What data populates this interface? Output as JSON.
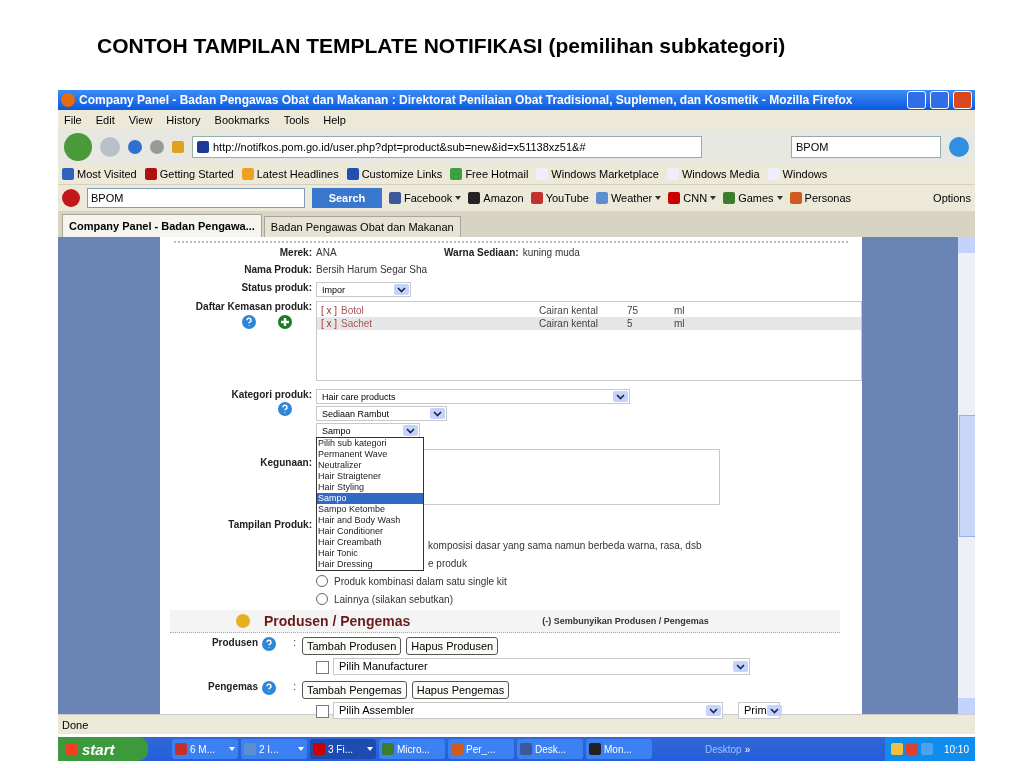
{
  "slide_title": "CONTOH TAMPILAN TEMPLATE NOTIFIKASI (pemilihan subkategori)",
  "window": {
    "title": "Company Panel - Badan Pengawas Obat dan Makanan : Direktorat Penilaian Obat Tradisional, Suplemen, dan Kosmetik - Mozilla Firefox"
  },
  "menu": [
    "File",
    "Edit",
    "View",
    "History",
    "Bookmarks",
    "Tools",
    "Help"
  ],
  "address": "http://notifkos.pom.go.id/user.php?dpt=product&sub=new&id=x51138xz51&#",
  "engine_search": "BPOM",
  "bookmarks": [
    "Most Visited",
    "Getting Started",
    "Latest Headlines",
    "Customize Links",
    "Free Hotmail",
    "Windows Marketplace",
    "Windows Media",
    "Windows"
  ],
  "ask_toolbar": {
    "search": "BPOM",
    "button": "Search",
    "links": [
      {
        "label": "Facebook",
        "menu": true
      },
      {
        "label": "Amazon",
        "menu": false
      },
      {
        "label": "YouTube",
        "menu": false
      },
      {
        "label": "Weather",
        "menu": true
      },
      {
        "label": "CNN",
        "menu": true
      },
      {
        "label": "Games",
        "menu": true
      },
      {
        "label": "Personas",
        "menu": false
      }
    ],
    "options": "Options"
  },
  "tabs": [
    {
      "label": "Company Panel - Badan Pengawa...",
      "selected": true
    },
    {
      "label": "Badan Pengawas Obat dan Makanan",
      "selected": false
    }
  ],
  "form": {
    "merek": {
      "label": "Merek:",
      "value": "ANA"
    },
    "warna": {
      "label": "Warna Sediaan:",
      "value": "kuning muda"
    },
    "nama": {
      "label": "Nama Produk:",
      "value": "Bersih Harum Segar Sha"
    },
    "status": {
      "label": "Status produk:",
      "value": "Impor"
    },
    "kemasan": {
      "label": "Daftar Kemasan produk:",
      "rows": [
        {
          "remove": "[ x ]",
          "name": "Botol",
          "form": "Cairan kental",
          "qty": "75",
          "unit": "ml",
          "selected": false
        },
        {
          "remove": "[ x ]",
          "name": "Sachet",
          "form": "Cairan kental",
          "qty": "5",
          "unit": "ml",
          "selected": true
        }
      ]
    },
    "kategori": {
      "label": "Kategori produk:",
      "selects": [
        "Hair care products",
        "Sediaan Rambut",
        "Sampo"
      ]
    },
    "subcategories": [
      {
        "label": "Pilih sub kategori",
        "selected": false
      },
      {
        "label": "Permanent Wave",
        "selected": false
      },
      {
        "label": "Neutralizer",
        "selected": false
      },
      {
        "label": "Hair Straigtener",
        "selected": false
      },
      {
        "label": "Hair Styling",
        "selected": false
      },
      {
        "label": "Sampo",
        "selected": true
      },
      {
        "label": "Sampo Ketombe",
        "selected": false
      },
      {
        "label": "Hair and Body Wash",
        "selected": false
      },
      {
        "label": "Hair Conditioner",
        "selected": false
      },
      {
        "label": "Hair Creambath",
        "selected": false
      },
      {
        "label": "Hair Tonic",
        "selected": false
      },
      {
        "label": "Hair Dressing",
        "selected": false
      }
    ],
    "kegunaan": {
      "label": "Kegunaan:"
    },
    "tampilan": {
      "label": "Tampilan Produk:",
      "options": [
        {
          "label": "komposisi dasar yang sama namun berbeda warna, rasa, dsb",
          "kind": "covered"
        },
        {
          "label": "e produk",
          "kind": "covered"
        },
        {
          "label": "Produk kombinasi dalam satu single kit",
          "kind": "full",
          "selected": false
        },
        {
          "label": "Lainnya (silakan sebutkan)",
          "kind": "full",
          "selected": false
        }
      ]
    },
    "section": {
      "title": "Produsen / Pengemas",
      "toggle": "(-) Sembunyikan Produsen / Pengemas"
    },
    "parties": [
      {
        "label": "Produsen",
        "separator": ":",
        "buttons": [
          "Tambah Produsen",
          "Hapus Produsen"
        ],
        "checked": false,
        "select": "Pilih Manufacturer"
      },
      {
        "label": "Pengemas",
        "separator": ":",
        "buttons": [
          "Tambah Pengemas",
          "Hapus Pengemas"
        ],
        "checked": false,
        "select": "Pilih Assembler",
        "extra_select": "Prim"
      }
    ]
  },
  "status_bar": "Done",
  "taskbar": {
    "start": "start",
    "items": [
      {
        "label": "6 M...",
        "group": true,
        "selected": false
      },
      {
        "label": "2 I...",
        "group": true,
        "selected": false
      },
      {
        "label": "3 Fi...",
        "group": true,
        "selected": true
      },
      {
        "label": "Micro...",
        "group": false,
        "selected": false
      },
      {
        "label": "Per_...",
        "group": false,
        "selected": false
      },
      {
        "label": "Desk...",
        "group": false,
        "selected": false
      },
      {
        "label": "Mon...",
        "group": false,
        "selected": false
      }
    ],
    "desktop": "Desktop",
    "more": "»",
    "clock": "10:10"
  }
}
